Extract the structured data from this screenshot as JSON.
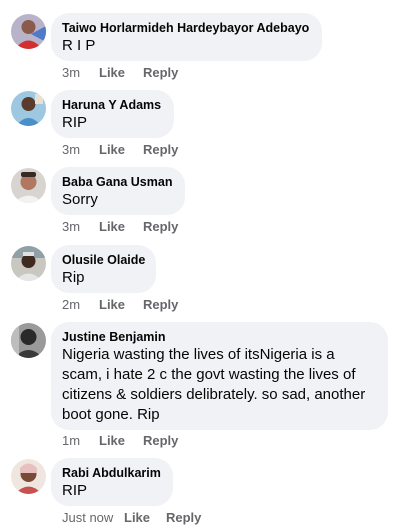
{
  "comments": [
    {
      "author": "Taiwo Horlarmideh Hardeybayor Adebayo",
      "text": "R I P",
      "time": "3m",
      "like_label": "Like",
      "reply_label": "Reply",
      "avatar_icon": "user-avatar-icon"
    },
    {
      "author": "Haruna Y Adams",
      "text": "RIP",
      "time": "3m",
      "like_label": "Like",
      "reply_label": "Reply",
      "avatar_icon": "user-avatar-icon"
    },
    {
      "author": "Baba Gana Usman",
      "text": "Sorry",
      "time": "3m",
      "like_label": "Like",
      "reply_label": "Reply",
      "avatar_icon": "user-avatar-icon"
    },
    {
      "author": "Olusile Olaide",
      "text": "Rip",
      "time": "2m",
      "like_label": "Like",
      "reply_label": "Reply",
      "avatar_icon": "user-avatar-icon"
    },
    {
      "author": "Justine Benjamin",
      "text": "Nigeria wasting the lives of itsNigeria is a scam, i hate 2 c the govt wasting the lives of citizens & soldiers delibrately. so sad, another boot gone. Rip",
      "time": "1m",
      "like_label": "Like",
      "reply_label": "Reply",
      "avatar_icon": "user-avatar-icon"
    },
    {
      "author": "Rabi Abdulkarim",
      "text": "RIP",
      "time": "Just now",
      "like_label": "Like",
      "reply_label": "Reply",
      "avatar_icon": "user-avatar-icon"
    }
  ],
  "colors": {
    "bubble_bg": "#f0f2f5",
    "text": "#050505",
    "meta": "#65676b"
  }
}
